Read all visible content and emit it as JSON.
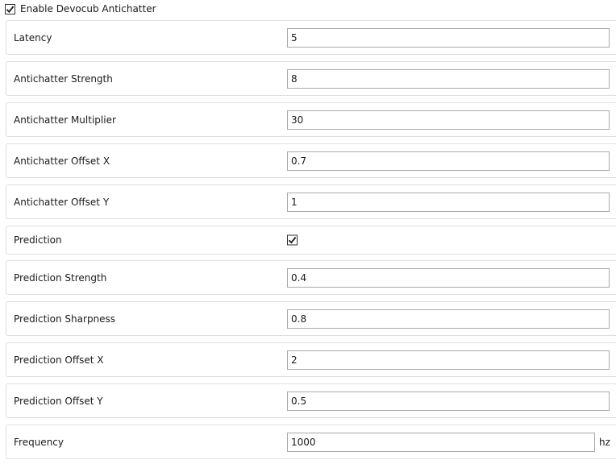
{
  "enable": {
    "label": "Enable Devocub Antichatter",
    "checked": true
  },
  "settings": [
    {
      "label": "Latency",
      "value": "5"
    },
    {
      "label": "Antichatter Strength",
      "value": "8"
    },
    {
      "label": "Antichatter Multiplier",
      "value": "30"
    },
    {
      "label": "Antichatter Offset X",
      "value": "0.7"
    },
    {
      "label": "Antichatter Offset Y",
      "value": "1"
    },
    {
      "label": "Prediction",
      "checked": true
    },
    {
      "label": "Prediction Strength",
      "value": "0.4"
    },
    {
      "label": "Prediction Sharpness",
      "value": "0.8"
    },
    {
      "label": "Prediction Offset X",
      "value": "2"
    },
    {
      "label": "Prediction Offset Y",
      "value": "0.5"
    },
    {
      "label": "Frequency",
      "value": "1000",
      "unit": "hz"
    }
  ],
  "icons": {
    "checkmark": "check-icon"
  }
}
